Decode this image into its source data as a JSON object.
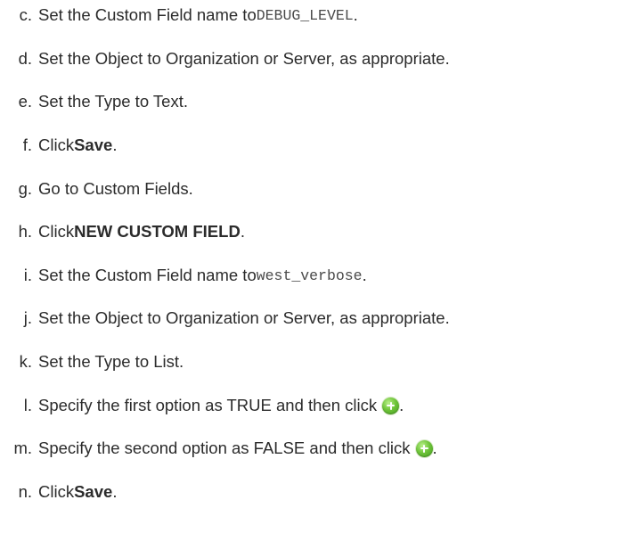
{
  "steps": [
    {
      "letter": "c.",
      "pre": "Set the Custom Field name to ",
      "code": "DEBUG_LEVEL",
      "post": "."
    },
    {
      "letter": "d.",
      "text": "Set the Object to Organization or Server, as appropriate."
    },
    {
      "letter": "e.",
      "text": "Set the Type to Text."
    },
    {
      "letter": "f.",
      "pre": "Click ",
      "bold": "Save",
      "post": "."
    },
    {
      "letter": "g.",
      "text": "Go to Custom Fields."
    },
    {
      "letter": "h.",
      "pre": "Click ",
      "bold": "NEW CUSTOM FIELD",
      "post": "."
    },
    {
      "letter": "i.",
      "pre": "Set the Custom Field name to ",
      "code": "west_verbose",
      "post": "."
    },
    {
      "letter": "j.",
      "text": "Set the Object to Organization or Server, as appropriate."
    },
    {
      "letter": "k.",
      "text": "Set the Type to List."
    },
    {
      "letter": "l.",
      "pre": "Specify the first option as TRUE and then click ",
      "icon": "add-circle-icon",
      "post": "."
    },
    {
      "letter": "m.",
      "pre": "Specify the second option as FALSE and then click ",
      "icon": "add-circle-icon",
      "post": "."
    },
    {
      "letter": "n.",
      "pre": "Click ",
      "bold": "Save",
      "post": "."
    }
  ],
  "colors": {
    "text": "#2b2b2b",
    "add_icon": "#4caf28"
  }
}
